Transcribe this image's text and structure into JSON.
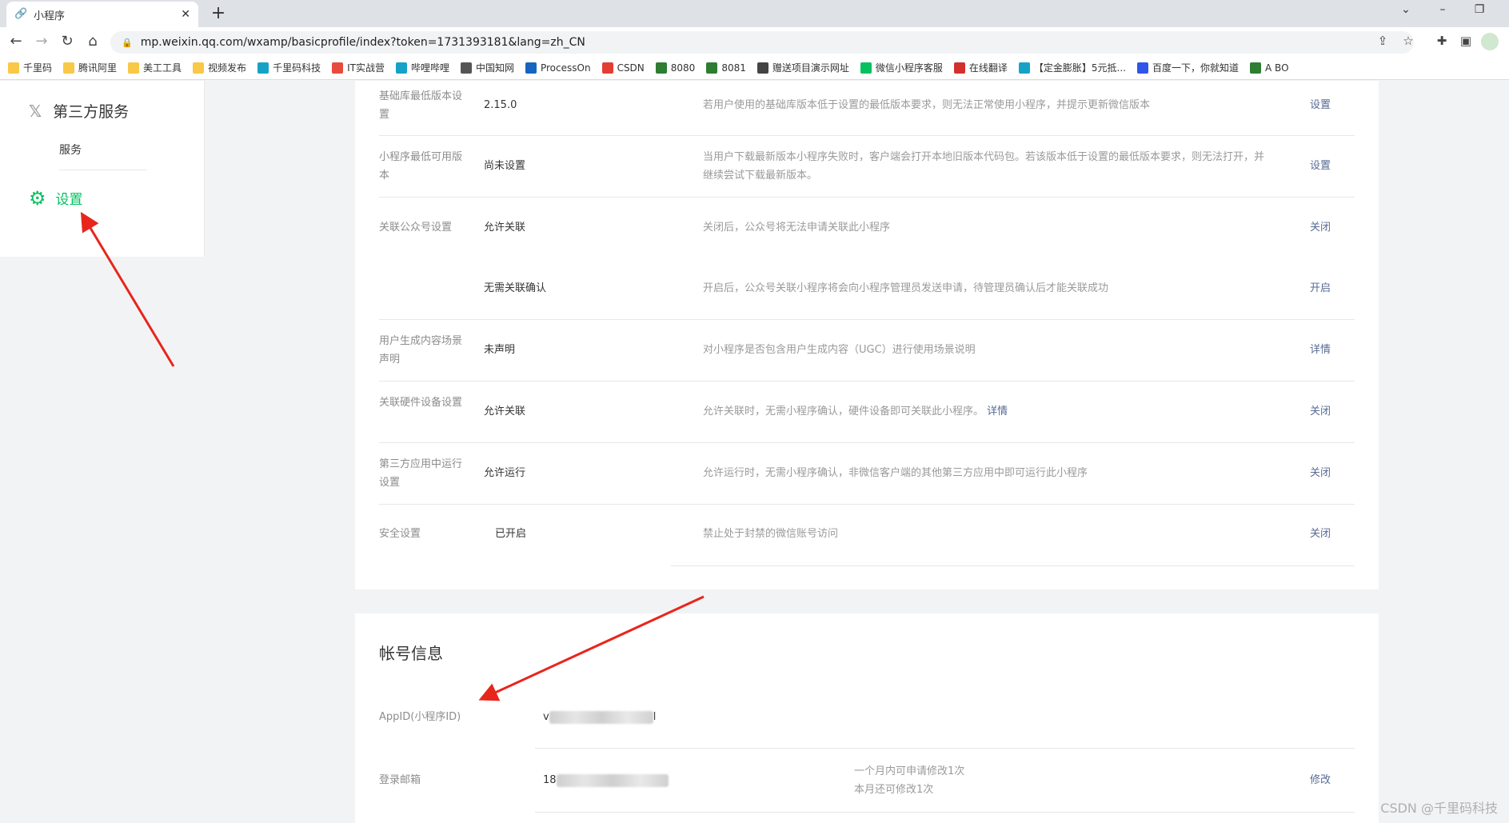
{
  "browser": {
    "tab_title": "小程序",
    "url": "mp.weixin.qq.com/wxamp/basicprofile/index?token=1731393181&lang=zh_CN",
    "bookmarks": [
      {
        "label": "千里码",
        "color": "#f9c846"
      },
      {
        "label": "腾讯阿里",
        "color": "#f9c846"
      },
      {
        "label": "美工工具",
        "color": "#f9c846"
      },
      {
        "label": "视频发布",
        "color": "#f9c846"
      },
      {
        "label": "千里码科技",
        "color": "#16a2c7"
      },
      {
        "label": "IT实战营",
        "color": "#e84b3c"
      },
      {
        "label": "哔哩哔哩",
        "color": "#16a2c7"
      },
      {
        "label": "中国知网",
        "color": "#555555"
      },
      {
        "label": "ProcessOn",
        "color": "#1565c0"
      },
      {
        "label": "CSDN",
        "color": "#e33e33"
      },
      {
        "label": "8080",
        "color": "#2e7d32"
      },
      {
        "label": "8081",
        "color": "#2e7d32"
      },
      {
        "label": "赠送项目演示网址",
        "color": "#444444"
      },
      {
        "label": "微信小程序客服",
        "color": "#07c160"
      },
      {
        "label": "在线翻译",
        "color": "#d32f2f"
      },
      {
        "label": "【定金膨胀】5元抵...",
        "color": "#16a2c7"
      },
      {
        "label": "百度一下，你就知道",
        "color": "#2f54eb"
      },
      {
        "label": "A BO",
        "color": "#2e7d32"
      }
    ]
  },
  "sidebar": {
    "section_title": "第三方服务",
    "service_label": "服务",
    "settings_label": "设置"
  },
  "settings_rows": [
    {
      "label": "基础库最低版本设置",
      "value": "2.15.0",
      "desc": "若用户使用的基础库版本低于设置的最低版本要求，则无法正常使用小程序，并提示更新微信版本",
      "action": "设置"
    },
    {
      "label": "小程序最低可用版本",
      "value": "尚未设置",
      "desc": "当用户下载最新版本小程序失败时，客户端会打开本地旧版本代码包。若该版本低于设置的最低版本要求，则无法打开，并继续尝试下载最新版本。",
      "action": "设置"
    },
    {
      "label": "关联公众号设置",
      "value": "允许关联",
      "desc": "关闭后，公众号将无法申请关联此小程序",
      "action": "关闭"
    },
    {
      "label": "",
      "value": "无需关联确认",
      "desc": "开启后，公众号关联小程序将会向小程序管理员发送申请，待管理员确认后才能关联成功",
      "action": "开启"
    },
    {
      "label": "用户生成内容场景声明",
      "value": "未声明",
      "desc": "对小程序是否包含用户生成内容（UGC）进行使用场景说明",
      "action": "详情"
    },
    {
      "label": "关联硬件设备设置",
      "value": "允许关联",
      "desc": "允许关联时，无需小程序确认，硬件设备即可关联此小程序。",
      "desc_link": "详情",
      "action": "关闭"
    },
    {
      "label": "第三方应用中运行设置",
      "value": "允许运行",
      "desc": "允许运行时，无需小程序确认，非微信客户端的其他第三方应用中即可运行此小程序",
      "action": "关闭"
    },
    {
      "label": "安全设置",
      "value": "已开启",
      "desc": "禁止处于封禁的微信账号访问",
      "action": "关闭"
    }
  ],
  "account": {
    "title": "帐号信息",
    "appid_label": "AppID(小程序ID)",
    "appid_value_prefix": "v",
    "appid_value_suffix": "l",
    "email_label": "登录邮箱",
    "email_value_prefix": "18",
    "email_note1": "一个月内可申请修改1次",
    "email_note2": "本月还可修改1次",
    "email_action": "修改"
  },
  "watermark": "CSDN @千里码科技"
}
